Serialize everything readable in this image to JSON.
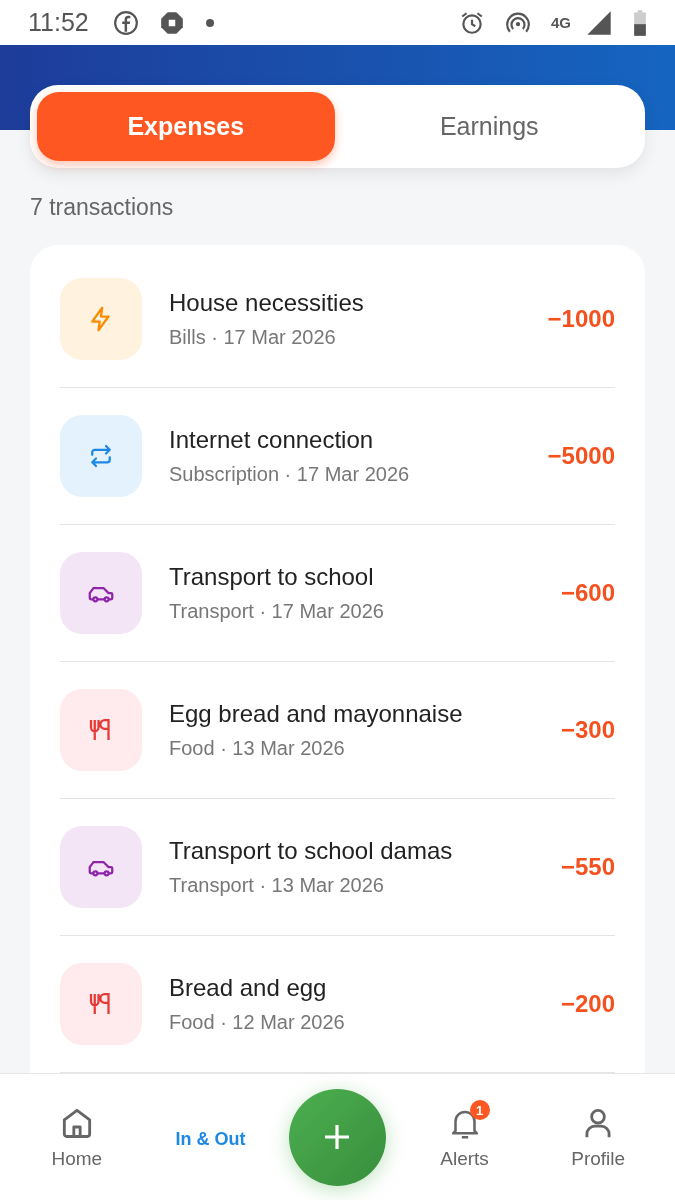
{
  "status_bar": {
    "time": "11:52",
    "network": "4G"
  },
  "tabs": [
    {
      "label": "Expenses",
      "selected": true
    },
    {
      "label": "Earnings",
      "selected": false
    }
  ],
  "count": "7 transactions",
  "transactions": [
    {
      "kind": "bills",
      "title": "House necessities",
      "meta": "Bills · 17 Mar 2026",
      "amount": "−1000"
    },
    {
      "kind": "subscription",
      "title": "Internet connection",
      "meta": "Subscription · 17 Mar 2026",
      "amount": "−5000"
    },
    {
      "kind": "transport",
      "title": "Transport to school",
      "meta": "Transport · 17 Mar 2026",
      "amount": "−600"
    },
    {
      "kind": "food",
      "title": "Egg bread and mayonnaise",
      "meta": "Food · 13 Mar 2026",
      "amount": "−300"
    },
    {
      "kind": "transport",
      "title": "Transport to school damas",
      "meta": "Transport · 13 Mar 2026",
      "amount": "−550"
    },
    {
      "kind": "food",
      "title": "Bread and egg",
      "meta": "Food · 12 Mar 2026",
      "amount": "−200"
    }
  ],
  "bottom_nav": [
    {
      "kind": "home",
      "label": "Home",
      "selected": false
    },
    {
      "kind": "text",
      "label": "In & Out",
      "selected": true
    },
    {
      "kind": "add"
    },
    {
      "kind": "alerts",
      "label": "Alerts",
      "selected": false,
      "badge": "1"
    },
    {
      "kind": "profile",
      "label": "Profile",
      "selected": false
    }
  ]
}
